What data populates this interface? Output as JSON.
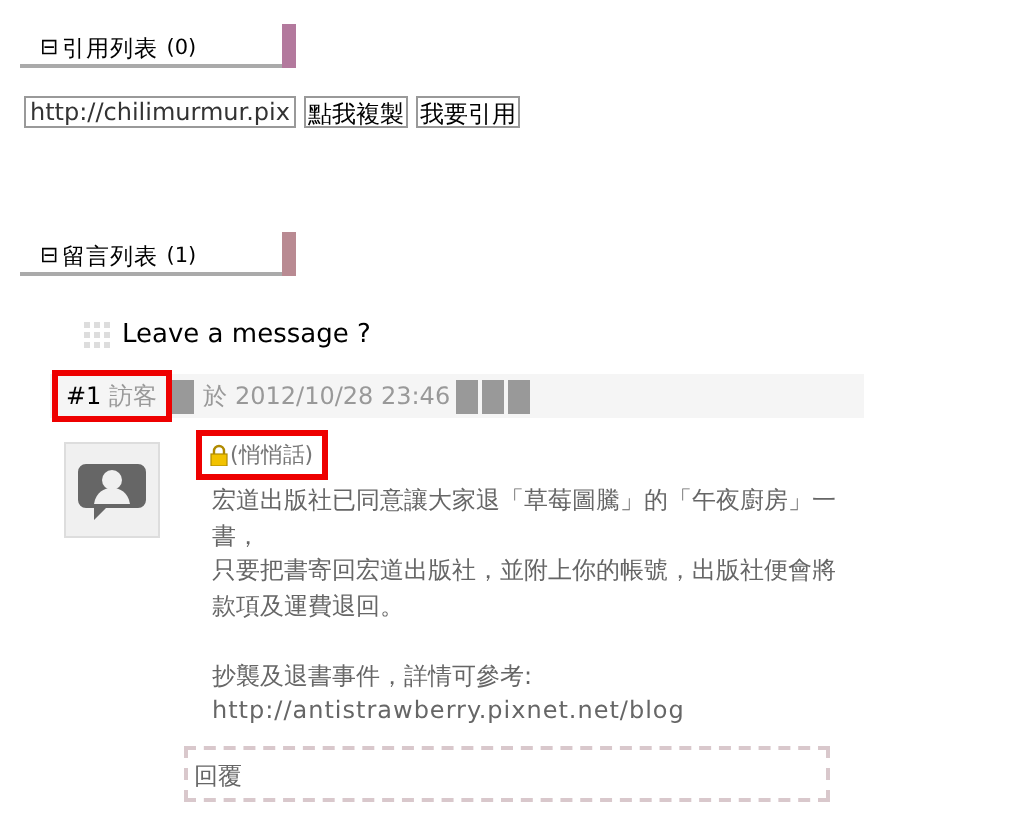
{
  "trackback": {
    "header": {
      "toggle": "⊟",
      "title": "引用列表",
      "count": "(0)"
    },
    "url_field": {
      "value": "http://chilimurmur.pix"
    },
    "buttons": [
      "點我複製",
      "我要引用"
    ]
  },
  "comments": {
    "header": {
      "toggle": "⊟",
      "title": "留言列表",
      "count": "(1)"
    },
    "leave_message": "Leave a message ?",
    "items": [
      {
        "number": "#1",
        "author": "訪客",
        "highlighted": true,
        "date": "於 2012/10/28 23:46",
        "private_label": "(悄悄話)",
        "private_highlighted": true,
        "blocks": [
          {
            "lines": [
              "宏道出版社已同意讓大家退「草莓圖騰」的「午夜廚房」一書，",
              "只要把書寄回宏道出版社，並附上你的帳號，出版社便會將款項及運費退回。"
            ]
          },
          {
            "lines": [
              "抄襲及退書事件，詳情可參考:"
            ],
            "link": "http://antistrawberry.pixnet.net/blog"
          }
        ],
        "reply": "回覆"
      }
    ]
  }
}
